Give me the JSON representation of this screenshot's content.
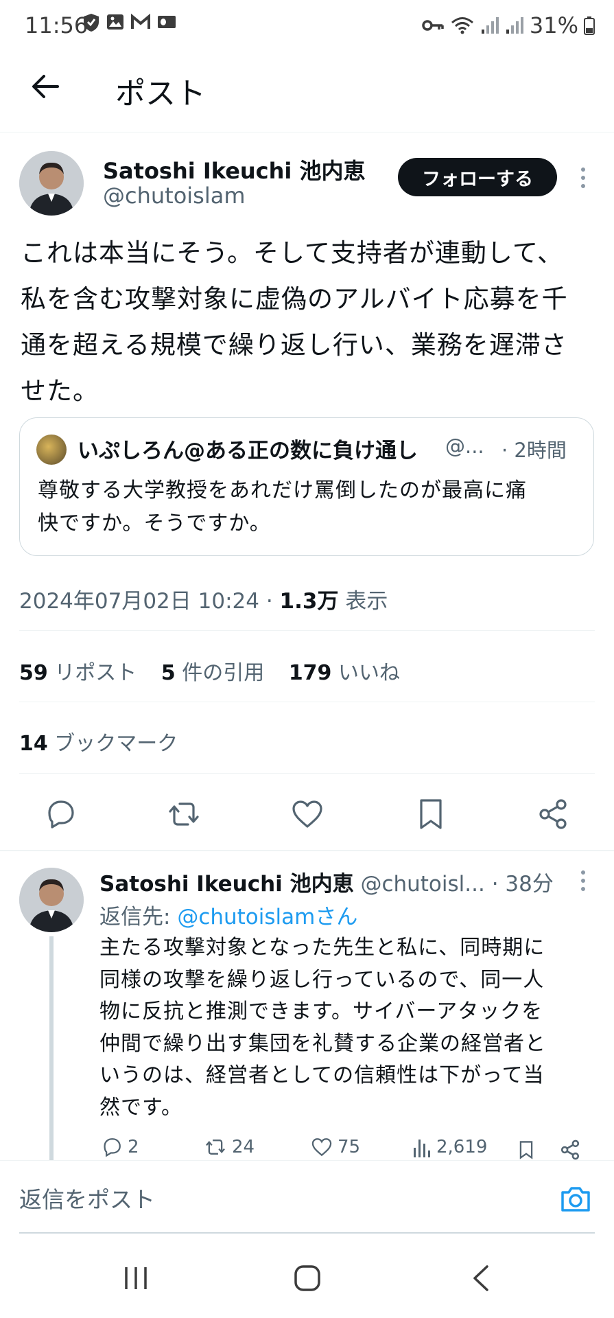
{
  "status_bar": {
    "time": "11:56",
    "battery": "31%"
  },
  "header": {
    "title": "ポスト"
  },
  "post": {
    "author_name": "Satoshi Ikeuchi 池内恵",
    "author_handle": "@chutoislam",
    "follow_label": "フォローする",
    "body_lines": [
      "これは本当にそう。そして支持者が連動して、",
      "私を含む攻撃対象に虚偽のアルバイト応募を千",
      "通を超える規模で繰り返し行い、業務を遅滞さ",
      "せた。"
    ],
    "quote": {
      "author_name": "いぷしろん@ある正の数に負け通し",
      "author_handle": "@...",
      "time": "· 2時間",
      "text_lines": [
        "尊敬する大学教授をあれだけ罵倒したのが最高に痛",
        "快ですか。そうですか。"
      ]
    },
    "timestamp": "2024年07月02日 10:24 ·",
    "views_count": "1.3万",
    "views_label": "表示",
    "reposts_count": "59",
    "reposts_label": "リポスト",
    "quotes_count": "5",
    "quotes_label": "件の引用",
    "likes_count": "179",
    "likes_label": "いいね",
    "bookmarks_count": "14",
    "bookmarks_label": "ブックマーク"
  },
  "reply": {
    "author_name": "Satoshi Ikeuchi 池内恵",
    "author_handle": "@chutoisl...",
    "time": "· 38分",
    "replying_to_prefix": "返信先:",
    "replying_to_handle": "@chutoislamさん",
    "body_lines": [
      "主たる攻撃対象となった先生と私に、同時期に",
      "同様の攻撃を繰り返し行っているので、同一人",
      "物に反抗と推測できます。サイバーアタックを",
      "仲間で繰り出す集団を礼賛する企業の経営者と",
      "いうのは、経営者としての信頼性は下がって当",
      "然です。"
    ],
    "replies": "2",
    "reposts": "24",
    "likes": "75",
    "views": "2,619"
  },
  "composer": {
    "placeholder": "返信をポスト"
  },
  "colors": {
    "link": "#1d9bf0",
    "text": "#0f1419",
    "muted": "#536471",
    "border": "#eff3f4"
  },
  "icons": [
    "back-arrow-icon",
    "reply-icon",
    "repost-icon",
    "like-icon",
    "bookmark-icon",
    "share-icon",
    "views-icon",
    "camera-icon",
    "more-icon"
  ]
}
